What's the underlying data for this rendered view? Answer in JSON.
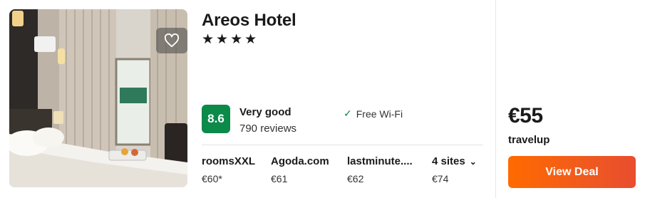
{
  "hotel": {
    "name": "Areos Hotel",
    "stars": "★★★★",
    "score": "8.6",
    "rating_label": "Very good",
    "reviews": "790 reviews",
    "amenity": "Free Wi-Fi"
  },
  "sites": [
    {
      "name": "roomsXXL",
      "price": "€60*"
    },
    {
      "name": "Agoda.com",
      "price": "€61"
    },
    {
      "name": "lastminute....",
      "price": "€62"
    },
    {
      "name": "4 sites",
      "price": "€74"
    }
  ],
  "deal": {
    "price": "€55",
    "provider": "travelup",
    "button": "View Deal"
  },
  "colors": {
    "score_bg": "#0b8a4a",
    "deal_button": "#f05a1f"
  },
  "icons": {
    "favorite": "heart-icon",
    "amenity": "check-icon",
    "more_sites": "chevron-down-icon"
  }
}
